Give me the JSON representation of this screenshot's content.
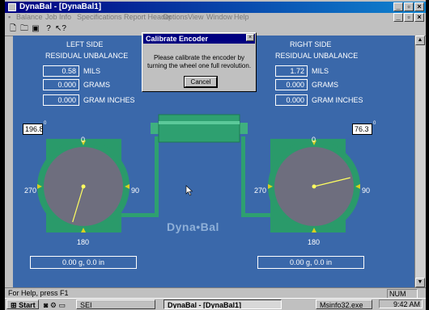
{
  "window": {
    "title": "DynaBal - [DynaBal1]",
    "menu": [
      "Balance",
      "Job Info",
      "Specifications",
      "Report Header",
      "Options",
      "View",
      "Window",
      "Help"
    ]
  },
  "left": {
    "title": "LEFT SIDE",
    "subtitle": "RESIDUAL UNBALANCE",
    "values": [
      {
        "value": "0.58",
        "unit": "MILS"
      },
      {
        "value": "0.000",
        "unit": "GRAMS"
      },
      {
        "value": "0.000",
        "unit": "GRAM INCHES"
      }
    ],
    "angle": "196.8",
    "angle_deg": 196.8,
    "readout": "0.00 g,  0.0 in"
  },
  "right": {
    "title": "RIGHT SIDE",
    "subtitle": "RESIDUAL UNBALANCE",
    "values": [
      {
        "value": "1.72",
        "unit": "MILS"
      },
      {
        "value": "0.000",
        "unit": "GRAMS"
      },
      {
        "value": "0.000",
        "unit": "GRAM INCHES"
      }
    ],
    "angle": "76.3",
    "angle_deg": 76.3,
    "readout": "0.00 g,  0.0 in"
  },
  "dial_labels": {
    "top": "0",
    "right": "90",
    "bottom": "180",
    "left": "270"
  },
  "degree_mark": "0",
  "logo": "Dyna•Bal",
  "dialog": {
    "title": "Calibrate Encoder",
    "message": "Please calibrate the encoder by turning the wheel one full revolution.",
    "button": "Cancel"
  },
  "status": {
    "help": "For Help, press F1",
    "num": "NUM"
  },
  "taskbar": {
    "start": "Start",
    "items": [
      "SEI",
      "DynaBal - [DynaBal1]",
      "Msinfo32.exe"
    ],
    "clock": "9:42 AM"
  },
  "colors": {
    "client_bg": "#3a68aa",
    "dial_green": "#2a9a6a",
    "shaft_green": "#2ea070",
    "dial_face": "#6e6e7e"
  }
}
